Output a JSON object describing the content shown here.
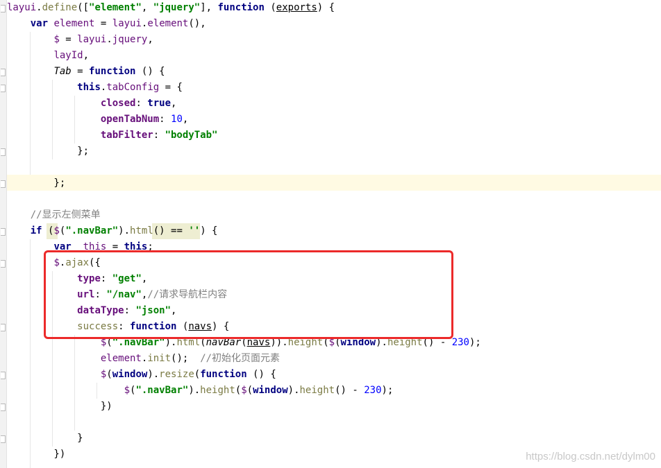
{
  "watermark": "https://blog.csdn.net/dylm00",
  "lines": [
    [
      {
        "t": "layui",
        "c": "pc"
      },
      {
        "t": ".",
        "c": ""
      },
      {
        "t": "define",
        "c": "fn"
      },
      {
        "t": "([",
        "c": ""
      },
      {
        "t": "\"element\"",
        "c": "str"
      },
      {
        "t": ", ",
        "c": ""
      },
      {
        "t": "\"jquery\"",
        "c": "str"
      },
      {
        "t": "], ",
        "c": ""
      },
      {
        "t": "function",
        "c": "kw"
      },
      {
        "t": " (",
        "c": ""
      },
      {
        "t": "exports",
        "c": "ul"
      },
      {
        "t": ") {",
        "c": ""
      }
    ],
    [
      {
        "t": "    ",
        "c": ""
      },
      {
        "t": "var",
        "c": "kw"
      },
      {
        "t": " ",
        "c": ""
      },
      {
        "t": "element",
        "c": "pc"
      },
      {
        "t": " = ",
        "c": ""
      },
      {
        "t": "layui",
        "c": "pc"
      },
      {
        "t": ".",
        "c": ""
      },
      {
        "t": "element",
        "c": "pc"
      },
      {
        "t": "(),",
        "c": ""
      }
    ],
    [
      {
        "t": "        ",
        "c": ""
      },
      {
        "t": "$",
        "c": "pc"
      },
      {
        "t": " = ",
        "c": ""
      },
      {
        "t": "layui",
        "c": "pc"
      },
      {
        "t": ".",
        "c": ""
      },
      {
        "t": "jquery",
        "c": "pc"
      },
      {
        "t": ",",
        "c": ""
      }
    ],
    [
      {
        "t": "        ",
        "c": ""
      },
      {
        "t": "layId",
        "c": "pc"
      },
      {
        "t": ",",
        "c": ""
      }
    ],
    [
      {
        "t": "        ",
        "c": ""
      },
      {
        "t": "Tab",
        "c": "it"
      },
      {
        "t": " = ",
        "c": ""
      },
      {
        "t": "function",
        "c": "kw"
      },
      {
        "t": " () {",
        "c": ""
      }
    ],
    [
      {
        "t": "            ",
        "c": ""
      },
      {
        "t": "this",
        "c": "kw"
      },
      {
        "t": ".",
        "c": ""
      },
      {
        "t": "tabConfig",
        "c": "pc"
      },
      {
        "t": " = {",
        "c": ""
      }
    ],
    [
      {
        "t": "                ",
        "c": ""
      },
      {
        "t": "closed",
        "c": "prop"
      },
      {
        "t": ": ",
        "c": ""
      },
      {
        "t": "true",
        "c": "kw"
      },
      {
        "t": ",",
        "c": ""
      }
    ],
    [
      {
        "t": "                ",
        "c": ""
      },
      {
        "t": "openTabNum",
        "c": "prop"
      },
      {
        "t": ": ",
        "c": ""
      },
      {
        "t": "10",
        "c": "num"
      },
      {
        "t": ",",
        "c": ""
      }
    ],
    [
      {
        "t": "                ",
        "c": ""
      },
      {
        "t": "tabFilter",
        "c": "prop"
      },
      {
        "t": ": ",
        "c": ""
      },
      {
        "t": "\"bodyTab\"",
        "c": "str"
      }
    ],
    [
      {
        "t": "            };",
        "c": ""
      }
    ],
    [],
    [
      {
        "t": "        };",
        "c": ""
      }
    ],
    [],
    [
      {
        "t": "    ",
        "c": ""
      },
      {
        "t": "//显示左侧菜单",
        "c": "cmt"
      }
    ],
    [
      {
        "t": "    ",
        "c": ""
      },
      {
        "t": "if",
        "c": "kw"
      },
      {
        "t": " (",
        "c": ""
      },
      {
        "t": "$",
        "c": "pc"
      },
      {
        "t": "(",
        "c": ""
      },
      {
        "t": "\".navBar\"",
        "c": "str"
      },
      {
        "t": ").",
        "c": ""
      },
      {
        "t": "html",
        "c": "fn"
      },
      {
        "t": "() == ",
        "c": ""
      },
      {
        "t": "''",
        "c": "str"
      },
      {
        "t": ") {",
        "c": ""
      }
    ],
    [
      {
        "t": "        ",
        "c": ""
      },
      {
        "t": "var",
        "c": "kw"
      },
      {
        "t": " ",
        "c": ""
      },
      {
        "t": "_this",
        "c": "pc"
      },
      {
        "t": " = ",
        "c": ""
      },
      {
        "t": "this",
        "c": "kw"
      },
      {
        "t": ";",
        "c": ""
      }
    ],
    [
      {
        "t": "        ",
        "c": ""
      },
      {
        "t": "$",
        "c": "pc"
      },
      {
        "t": ".",
        "c": ""
      },
      {
        "t": "ajax",
        "c": "fn"
      },
      {
        "t": "({",
        "c": ""
      }
    ],
    [
      {
        "t": "            ",
        "c": ""
      },
      {
        "t": "type",
        "c": "prop"
      },
      {
        "t": ": ",
        "c": ""
      },
      {
        "t": "\"get\"",
        "c": "str"
      },
      {
        "t": ",",
        "c": ""
      }
    ],
    [
      {
        "t": "            ",
        "c": ""
      },
      {
        "t": "url",
        "c": "prop"
      },
      {
        "t": ": ",
        "c": ""
      },
      {
        "t": "\"/nav\"",
        "c": "str"
      },
      {
        "t": ",",
        "c": ""
      },
      {
        "t": "//请求导航栏内容",
        "c": "cmt"
      }
    ],
    [
      {
        "t": "            ",
        "c": ""
      },
      {
        "t": "dataType",
        "c": "prop"
      },
      {
        "t": ": ",
        "c": ""
      },
      {
        "t": "\"json\"",
        "c": "str"
      },
      {
        "t": ",",
        "c": ""
      }
    ],
    [
      {
        "t": "            ",
        "c": ""
      },
      {
        "t": "success",
        "c": "fn"
      },
      {
        "t": ": ",
        "c": ""
      },
      {
        "t": "function",
        "c": "kw"
      },
      {
        "t": " (",
        "c": ""
      },
      {
        "t": "navs",
        "c": "ul"
      },
      {
        "t": ") {",
        "c": ""
      }
    ],
    [
      {
        "t": "                ",
        "c": ""
      },
      {
        "t": "$",
        "c": "pc"
      },
      {
        "t": "(",
        "c": ""
      },
      {
        "t": "\".navBar\"",
        "c": "str"
      },
      {
        "t": ").",
        "c": ""
      },
      {
        "t": "html",
        "c": "fn"
      },
      {
        "t": "(",
        "c": ""
      },
      {
        "t": "navBar",
        "c": "it"
      },
      {
        "t": "(",
        "c": ""
      },
      {
        "t": "navs",
        "c": "ul"
      },
      {
        "t": ")).",
        "c": ""
      },
      {
        "t": "height",
        "c": "fn"
      },
      {
        "t": "(",
        "c": ""
      },
      {
        "t": "$",
        "c": "pc"
      },
      {
        "t": "(",
        "c": ""
      },
      {
        "t": "window",
        "c": "kw"
      },
      {
        "t": ").",
        "c": ""
      },
      {
        "t": "height",
        "c": "fn"
      },
      {
        "t": "() - ",
        "c": ""
      },
      {
        "t": "230",
        "c": "num"
      },
      {
        "t": ");",
        "c": ""
      }
    ],
    [
      {
        "t": "                ",
        "c": ""
      },
      {
        "t": "element",
        "c": "pc"
      },
      {
        "t": ".",
        "c": ""
      },
      {
        "t": "init",
        "c": "fn"
      },
      {
        "t": "();  ",
        "c": ""
      },
      {
        "t": "//初始化页面元素",
        "c": "cmt"
      }
    ],
    [
      {
        "t": "                ",
        "c": ""
      },
      {
        "t": "$",
        "c": "pc"
      },
      {
        "t": "(",
        "c": ""
      },
      {
        "t": "window",
        "c": "kw"
      },
      {
        "t": ").",
        "c": ""
      },
      {
        "t": "resize",
        "c": "fn"
      },
      {
        "t": "(",
        "c": ""
      },
      {
        "t": "function",
        "c": "kw"
      },
      {
        "t": " () {",
        "c": ""
      }
    ],
    [
      {
        "t": "                    ",
        "c": ""
      },
      {
        "t": "$",
        "c": "pc"
      },
      {
        "t": "(",
        "c": ""
      },
      {
        "t": "\".navBar\"",
        "c": "str"
      },
      {
        "t": ").",
        "c": ""
      },
      {
        "t": "height",
        "c": "fn"
      },
      {
        "t": "(",
        "c": ""
      },
      {
        "t": "$",
        "c": "pc"
      },
      {
        "t": "(",
        "c": ""
      },
      {
        "t": "window",
        "c": "kw"
      },
      {
        "t": ").",
        "c": ""
      },
      {
        "t": "height",
        "c": "fn"
      },
      {
        "t": "() - ",
        "c": ""
      },
      {
        "t": "230",
        "c": "num"
      },
      {
        "t": ");",
        "c": ""
      }
    ],
    [
      {
        "t": "                })",
        "c": ""
      }
    ],
    [],
    [
      {
        "t": "            }",
        "c": ""
      }
    ],
    [
      {
        "t": "        })",
        "c": ""
      }
    ]
  ]
}
